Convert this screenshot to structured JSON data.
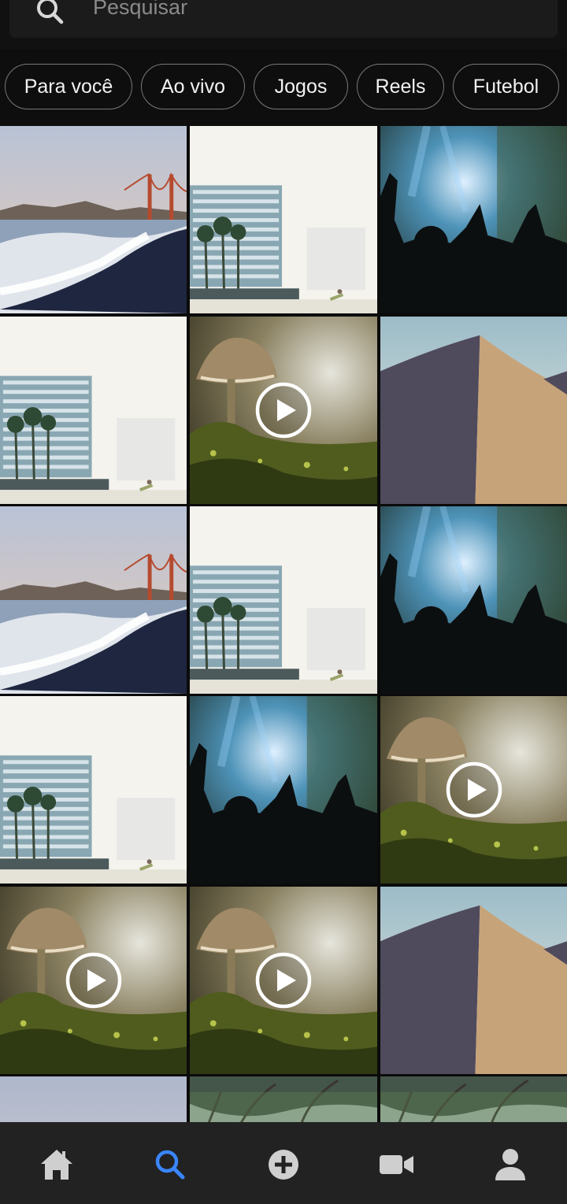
{
  "search": {
    "placeholder": "Pesquisar"
  },
  "chips": [
    "Para você",
    "Ao vivo",
    "Jogos",
    "Reels",
    "Futebol"
  ],
  "grid": {
    "tiles": [
      {
        "type": "beach",
        "video": false
      },
      {
        "type": "building",
        "video": false
      },
      {
        "type": "concert",
        "video": false
      },
      {
        "type": "building",
        "video": false
      },
      {
        "type": "mushroom",
        "video": true
      },
      {
        "type": "dune",
        "video": false
      },
      {
        "type": "beach",
        "video": false
      },
      {
        "type": "building",
        "video": false
      },
      {
        "type": "concert",
        "video": false
      },
      {
        "type": "building",
        "video": false
      },
      {
        "type": "concert",
        "video": false
      },
      {
        "type": "mushroom",
        "video": true
      },
      {
        "type": "mushroom",
        "video": true
      },
      {
        "type": "mushroom",
        "video": true
      },
      {
        "type": "dune",
        "video": false
      },
      {
        "type": "sky",
        "video": false
      },
      {
        "type": "forest",
        "video": false
      },
      {
        "type": "forest",
        "video": false
      }
    ]
  },
  "nav": {
    "items": [
      {
        "name": "home",
        "active": false
      },
      {
        "name": "search",
        "active": true
      },
      {
        "name": "add",
        "active": false
      },
      {
        "name": "video",
        "active": false
      },
      {
        "name": "profile",
        "active": false
      }
    ],
    "active_color": "#3a86ff",
    "inactive_color": "#cfcfcf"
  }
}
